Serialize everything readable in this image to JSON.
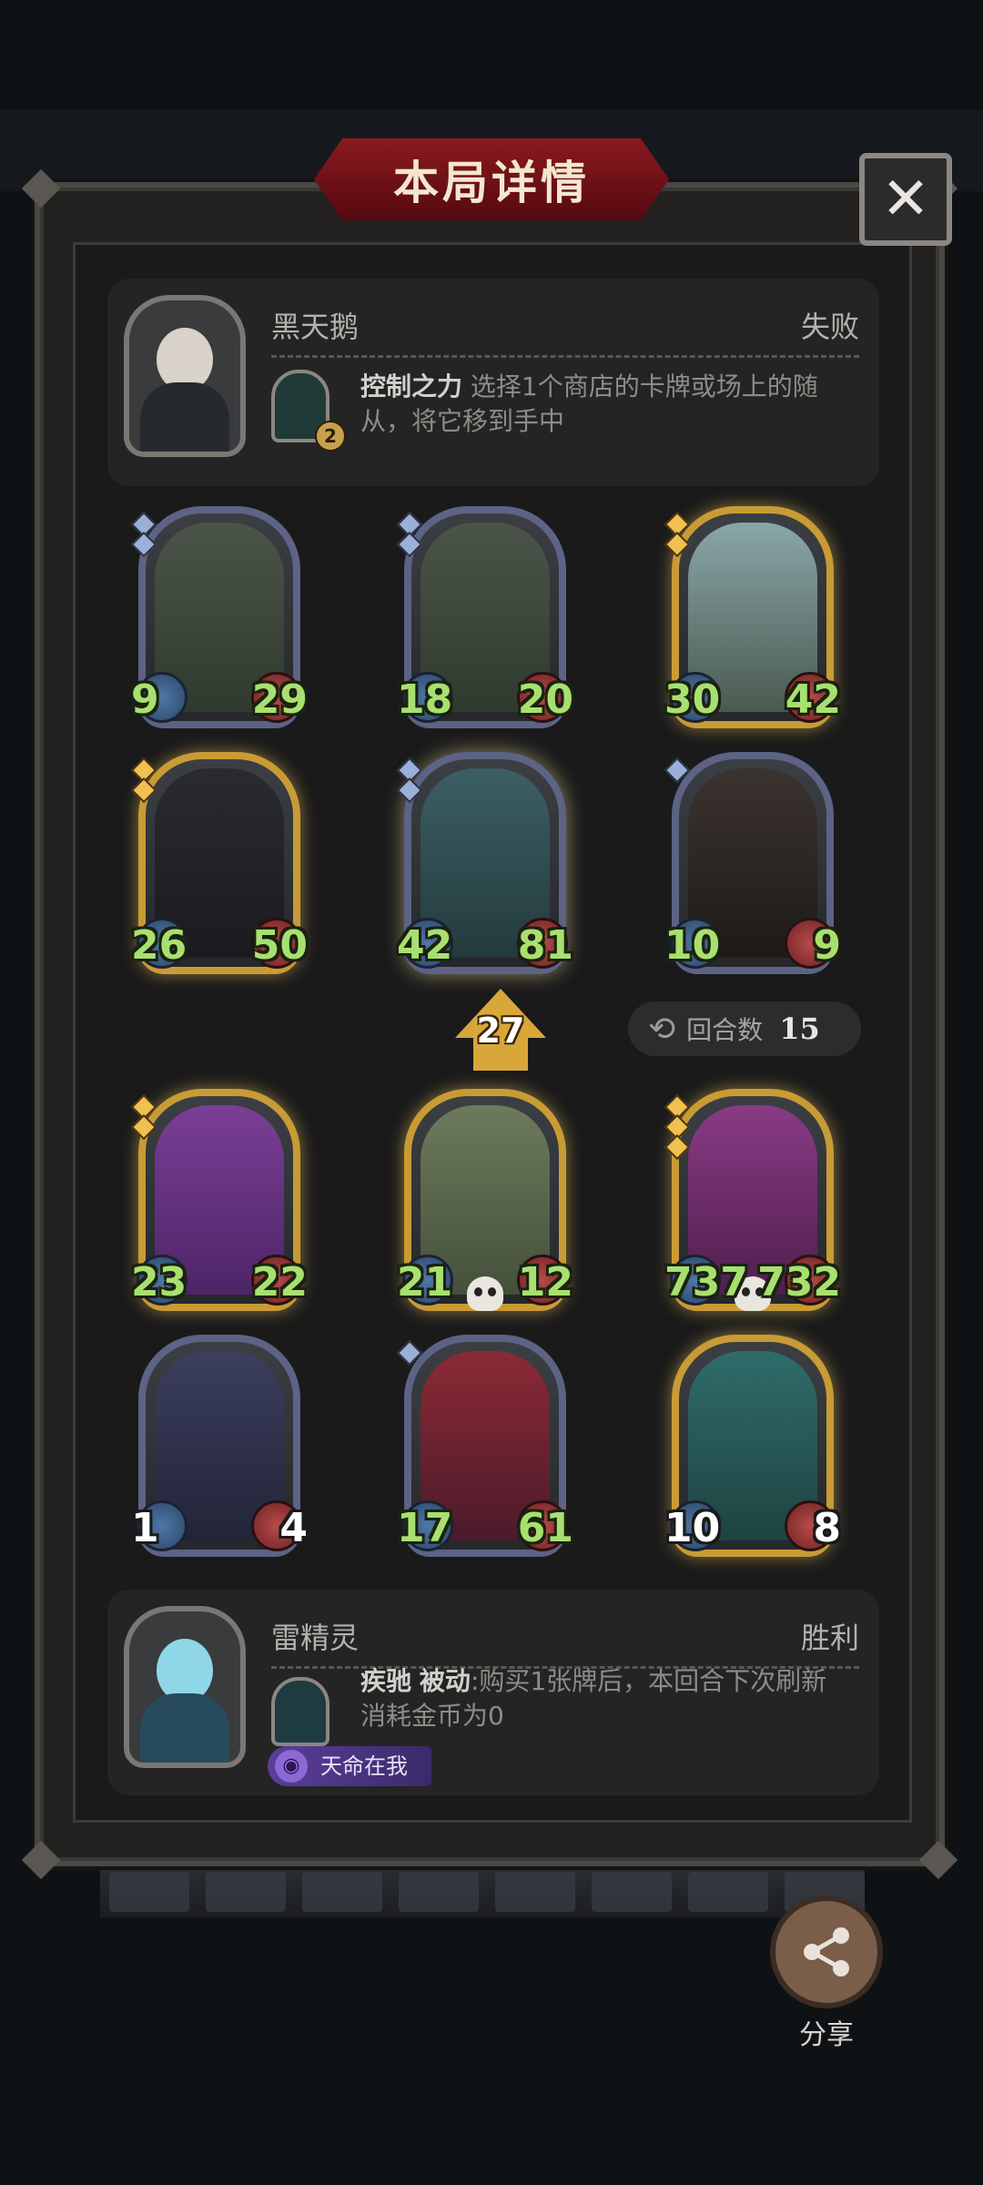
{
  "title": "本局详情",
  "close_glyph": "✕",
  "opponent": {
    "name": "黑天鹅",
    "result": "失败",
    "skill_name": "控制之力",
    "skill_desc": "选择1个商店的卡牌或场上的随从，将它移到手中",
    "skill_cost": "2"
  },
  "player": {
    "name": "雷精灵",
    "result": "胜利",
    "skill_name": "疾驰",
    "skill_keyword": "被动",
    "skill_desc": ":购买1张牌后，本回合下次刷新消耗金币为0",
    "tag": "天命在我"
  },
  "opponent_board": [
    {
      "attack": "9",
      "health": "29",
      "frame": "blue",
      "pips": 2,
      "art": "hooded-old-man"
    },
    {
      "attack": "18",
      "health": "20",
      "frame": "blue",
      "pips": 2,
      "art": "hooded-old-man"
    },
    {
      "attack": "30",
      "health": "42",
      "frame": "gold",
      "pips": 2,
      "art": "ghost-ship"
    },
    {
      "attack": "26",
      "health": "50",
      "frame": "gold",
      "pips": 2,
      "art": "mushroom-beast"
    },
    {
      "attack": "42",
      "health": "81",
      "frame": "blue",
      "pips": 2,
      "art": "iron-knight"
    },
    {
      "attack": "10",
      "health": "9",
      "frame": "blue",
      "pips": 1,
      "art": "tree-monster"
    }
  ],
  "level": "27",
  "round": {
    "label": "回合数",
    "value": "15"
  },
  "player_board": [
    {
      "attack": "23",
      "health": "22",
      "frame": "gold",
      "pips": 2,
      "art": "airship"
    },
    {
      "attack": "21",
      "health": "12",
      "frame": "gold",
      "pips": 0,
      "art": "scarecrow-girl",
      "skull": true
    },
    {
      "attack": "737",
      "health": "732",
      "frame": "gold",
      "pips": 3,
      "art": "flame-bear",
      "skull": true
    },
    {
      "attack": "1",
      "health": "4",
      "frame": "blue",
      "pips": 0,
      "art": "elf-witch",
      "white_stats": true
    },
    {
      "attack": "17",
      "health": "61",
      "frame": "blue",
      "pips": 1,
      "art": "clown"
    },
    {
      "attack": "10",
      "health": "8",
      "frame": "gold",
      "pips": 0,
      "art": "white-haired-sage",
      "white_stats": true
    }
  ],
  "share_label": "分享",
  "colors": {
    "accent_red": "#8a1a1f",
    "stat_green": "#a8e070",
    "gold_frame": "#c99b35",
    "blue_frame": "#5c6385"
  }
}
